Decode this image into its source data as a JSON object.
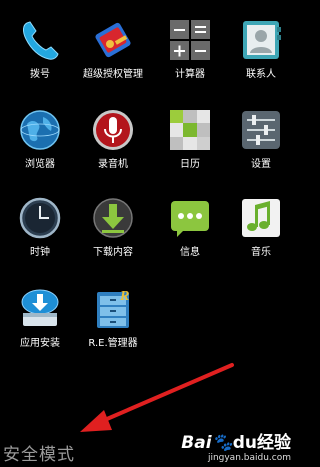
{
  "apps": [
    {
      "name": "dialer",
      "label": "拨号",
      "icon": "phone-icon"
    },
    {
      "name": "superuser",
      "label": "超级授权管理",
      "icon": "superuser-icon"
    },
    {
      "name": "calculator",
      "label": "计算器",
      "icon": "calculator-icon"
    },
    {
      "name": "contacts",
      "label": "联系人",
      "icon": "contacts-icon"
    },
    {
      "name": "browser",
      "label": "浏览器",
      "icon": "globe-icon"
    },
    {
      "name": "recorder",
      "label": "录音机",
      "icon": "microphone-icon"
    },
    {
      "name": "calendar",
      "label": "日历",
      "icon": "calendar-icon"
    },
    {
      "name": "settings",
      "label": "设置",
      "icon": "settings-sliders-icon"
    },
    {
      "name": "clock",
      "label": "时钟",
      "icon": "clock-icon"
    },
    {
      "name": "downloads",
      "label": "下载内容",
      "icon": "download-icon"
    },
    {
      "name": "messaging",
      "label": "信息",
      "icon": "message-icon"
    },
    {
      "name": "music",
      "label": "音乐",
      "icon": "music-note-icon"
    },
    {
      "name": "app-installer",
      "label": "应用安装",
      "icon": "installer-icon"
    },
    {
      "name": "re-manager",
      "label": "R.E.管理器",
      "icon": "file-cabinet-icon"
    }
  ],
  "safe_mode": {
    "label": "安全模式"
  },
  "annotation": {
    "arrow_color": "#e02020",
    "icon": "arrow-icon"
  },
  "watermark": {
    "brand_a": "Bai",
    "brand_b": "du",
    "brand_c": "经验",
    "url": "jingyan.baidu.com",
    "icon": "paw-icon"
  }
}
